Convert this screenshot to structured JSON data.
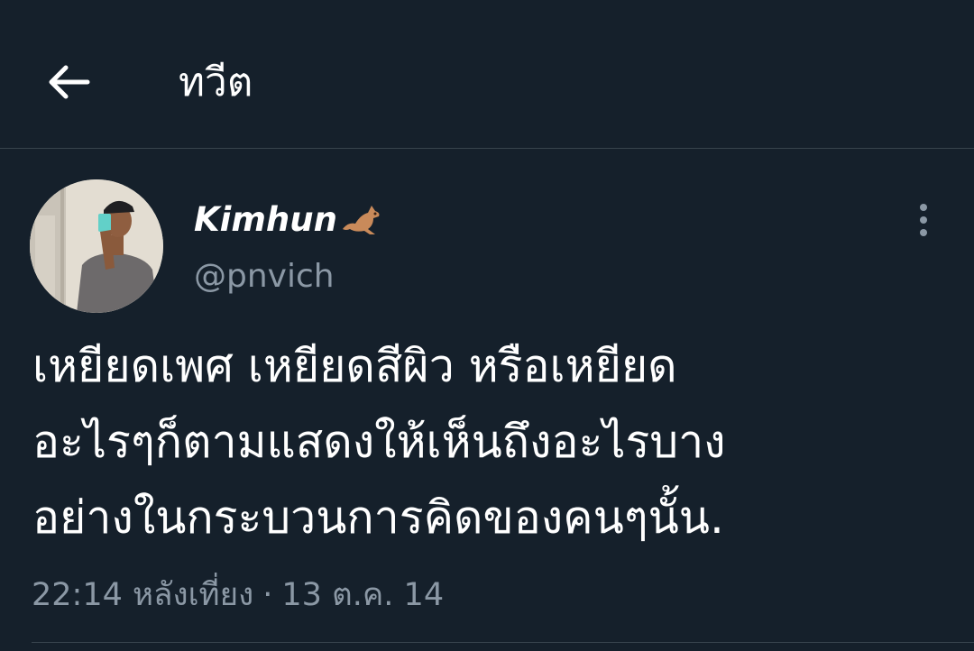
{
  "header": {
    "title": "ทวีต",
    "back_icon": "arrow-left-icon"
  },
  "tweet": {
    "author": {
      "display_name": "Kimhun",
      "emoji_icon": "kangaroo-emoji-icon",
      "handle": "@pnvich"
    },
    "text_lines": [
      "เหยียดเพศ เหยียดสีผิว หรือเหยียด",
      "อะไรๆก็ตามแสดงให้เห็นถึงอะไรบาง",
      "อย่างในกระบวนการคิดของคนๆนั้น."
    ],
    "time": "22:14 หลังเที่ยง",
    "separator": "·",
    "date": "13 ต.ค. 14",
    "more_icon": "more-vertical-icon"
  },
  "colors": {
    "background": "#15202b",
    "divider": "#38444d",
    "secondary_text": "#8b98a5",
    "primary_text": "#ffffff"
  }
}
